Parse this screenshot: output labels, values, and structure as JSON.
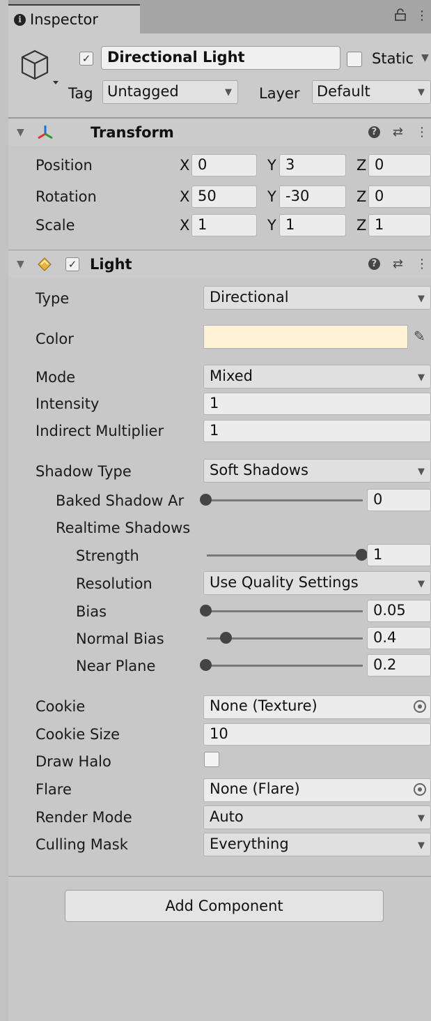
{
  "tab": {
    "icon": "info-icon",
    "label": "Inspector"
  },
  "tabbar_icons": {
    "lock": "lock-icon",
    "menu": "⋮"
  },
  "object": {
    "active": true,
    "name": "Directional Light",
    "static_label": "Static",
    "tag_label": "Tag",
    "tag_value": "Untagged",
    "layer_label": "Layer",
    "layer_value": "Default"
  },
  "transform": {
    "title": "Transform",
    "x": "X",
    "y": "Y",
    "z": "Z",
    "position": {
      "label": "Position",
      "x": "0",
      "y": "3",
      "z": "0"
    },
    "rotation": {
      "label": "Rotation",
      "x": "50",
      "y": "-30",
      "z": "0"
    },
    "scale": {
      "label": "Scale",
      "x": "1",
      "y": "1",
      "z": "1"
    }
  },
  "light": {
    "title": "Light",
    "enabled": true,
    "type": {
      "label": "Type",
      "value": "Directional"
    },
    "color": {
      "label": "Color",
      "value": "#fff2d6"
    },
    "mode": {
      "label": "Mode",
      "value": "Mixed"
    },
    "intensity": {
      "label": "Intensity",
      "value": "1"
    },
    "indirect": {
      "label": "Indirect Multiplier",
      "value": "1"
    },
    "shadow_type": {
      "label": "Shadow Type",
      "value": "Soft Shadows"
    },
    "baked_angle": {
      "label": "Baked Shadow Ar",
      "value": "0",
      "fraction": 0.0
    },
    "realtime_label": "Realtime Shadows",
    "strength": {
      "label": "Strength",
      "value": "1",
      "fraction": 1.0
    },
    "resolution": {
      "label": "Resolution",
      "value": "Use Quality Settings"
    },
    "bias": {
      "label": "Bias",
      "value": "0.05",
      "fraction": 0.0
    },
    "normal_bias": {
      "label": "Normal Bias",
      "value": "0.4",
      "fraction": 0.13
    },
    "near_plane": {
      "label": "Near Plane",
      "value": "0.2",
      "fraction": 0.0
    },
    "cookie": {
      "label": "Cookie",
      "value": "None (Texture)"
    },
    "cookie_size": {
      "label": "Cookie Size",
      "value": "10"
    },
    "draw_halo": {
      "label": "Draw Halo",
      "checked": false
    },
    "flare": {
      "label": "Flare",
      "value": "None (Flare)"
    },
    "render_mode": {
      "label": "Render Mode",
      "value": "Auto"
    },
    "culling_mask": {
      "label": "Culling Mask",
      "value": "Everything"
    }
  },
  "add_component": "Add Component"
}
